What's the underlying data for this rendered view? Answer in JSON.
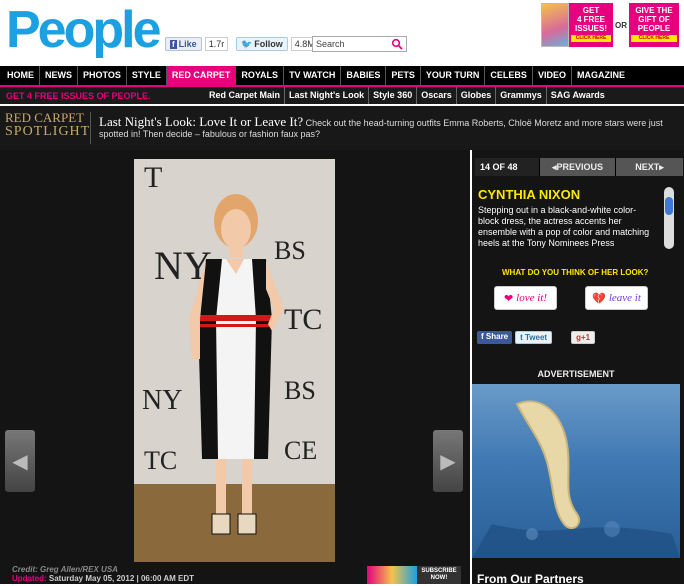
{
  "header": {
    "logo": "People",
    "fb_like_label": "Like",
    "fb_like_count": "1.7r",
    "twitter_label": "Follow",
    "twitter_count": "4.8M",
    "search_placeholder": "Search",
    "promo": {
      "offer1_line1": "GET",
      "offer1_line2": "4 FREE",
      "offer1_line3": "ISSUES!",
      "offer1_cta": "CLICK HERE",
      "or": "OR",
      "offer2_line1": "GIVE THE",
      "offer2_line2": "GIFT OF",
      "offer2_line3": "PEOPLE",
      "offer2_cta": "CLICK HERE"
    }
  },
  "nav": {
    "items": [
      "HOME",
      "NEWS",
      "PHOTOS",
      "STYLE",
      "RED CARPET",
      "ROYALS",
      "TV WATCH",
      "BABIES",
      "PETS",
      "YOUR TURN",
      "CELEBS",
      "VIDEO",
      "MAGAZINE"
    ],
    "active": "RED CARPET"
  },
  "subnav": {
    "promo": "GET 4 FREE ISSUES OF PEOPLE.",
    "items": [
      "Red Carpet Main",
      "Last Night's Look",
      "Style 360",
      "Oscars",
      "Globes",
      "Grammys",
      "SAG Awards"
    ]
  },
  "spotlight": {
    "logo_line1": "RED CARPET",
    "logo_line2": "SPOTLIGHT",
    "title": "Last Night's Look: Love It or Leave It?",
    "text": " Check out the head-turning outfits Emma Roberts, Chloë Moretz and more stars were just spotted in! Then decide – fabulous or fashion faux pas?"
  },
  "gallery": {
    "credit": "Credit: Greg Allen/REX USA",
    "updated_label": "Updated:",
    "updated_value": " Saturday May 05, 2012 | 06:00 AM EDT",
    "subscribe_label": "SUBSCRIBE NOW!"
  },
  "sidebar": {
    "counter": "14 OF 48",
    "prev_label": "◂PREVIOUS",
    "next_label": "NEXT▸",
    "name": "CYNTHIA NIXON",
    "description": "Stepping out in a black-and-white color-block dress, the actress accents her ensemble with a pop of color and matching heels at the Tony Nominees Press",
    "question": "WHAT DO YOU THINK OF HER LOOK?",
    "love_label": "love it!",
    "leave_label": "leave it",
    "share_fb": "Share",
    "share_tw": "Tweet",
    "share_gp": "+1",
    "ad_label": "ADVERTISEMENT",
    "partners": "From Our Partners"
  },
  "colors": {
    "brand_blue": "#1ba0e2",
    "brand_pink": "#e6007e",
    "accent_yellow": "#ffe600"
  }
}
